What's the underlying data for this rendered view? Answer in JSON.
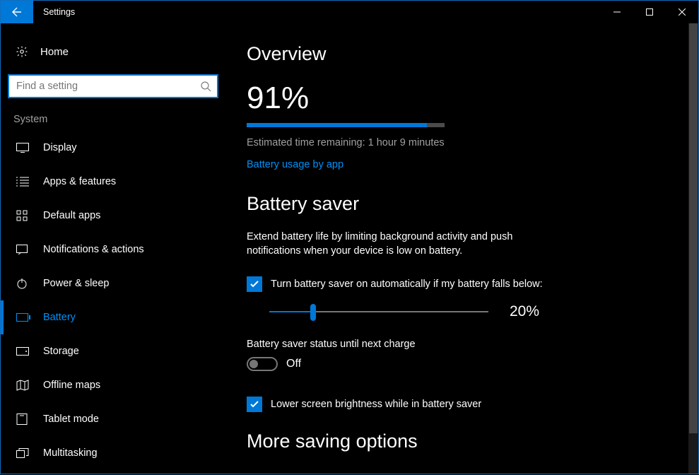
{
  "window": {
    "title": "Settings"
  },
  "home_label": "Home",
  "search": {
    "placeholder": "Find a setting"
  },
  "group": "System",
  "nav": [
    {
      "label": "Display"
    },
    {
      "label": "Apps & features"
    },
    {
      "label": "Default apps"
    },
    {
      "label": "Notifications & actions"
    },
    {
      "label": "Power & sleep"
    },
    {
      "label": "Battery",
      "selected": true
    },
    {
      "label": "Storage"
    },
    {
      "label": "Offline maps"
    },
    {
      "label": "Tablet mode"
    },
    {
      "label": "Multitasking"
    }
  ],
  "overview": {
    "heading": "Overview",
    "percent": "91%",
    "progress_fill_pct": 91,
    "remaining": "Estimated time remaining: 1 hour 9 minutes",
    "usage_link": "Battery usage by app"
  },
  "saver": {
    "heading": "Battery saver",
    "desc": "Extend battery life by limiting background activity and push notifications when your device is low on battery.",
    "auto_label": "Turn battery saver on automatically if my battery falls below:",
    "auto_checked": true,
    "threshold_pct": 20,
    "threshold_label": "20%",
    "status_label": "Battery saver status until next charge",
    "status_value": "Off",
    "status_on": false,
    "brightness_label": "Lower screen brightness while in battery saver",
    "brightness_checked": true
  },
  "more": {
    "heading": "More saving options"
  }
}
